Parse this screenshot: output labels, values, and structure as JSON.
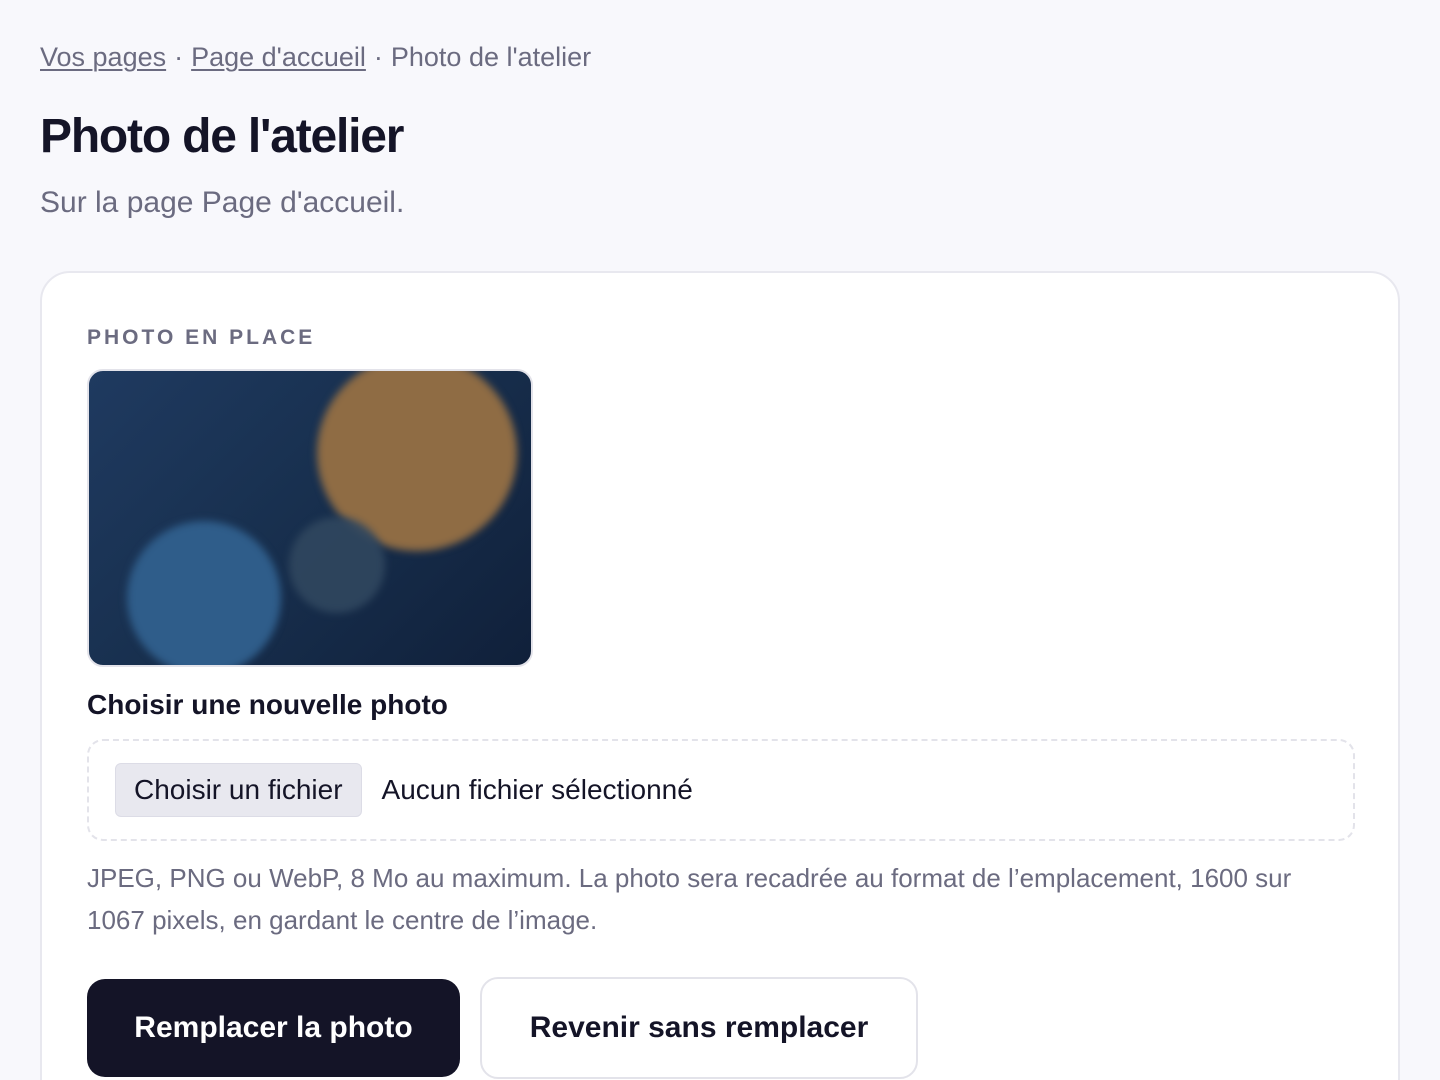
{
  "breadcrumb": {
    "items": [
      {
        "label": "Vos pages",
        "link": true
      },
      {
        "label": "Page d'accueil",
        "link": true
      },
      {
        "label": "Photo de l'atelier",
        "link": false
      }
    ],
    "separator": "·"
  },
  "header": {
    "title": "Photo de l'atelier",
    "subtitle": "Sur la page Page d'accueil."
  },
  "card": {
    "section_label": "PHOTO EN PLACE",
    "photo_alt": "Photo actuelle de l'atelier",
    "field_label": "Choisir une nouvelle photo",
    "file_input": {
      "button_label": "Choisir un fichier",
      "status": "Aucun fichier sélectionné"
    },
    "help_text": "JPEG, PNG ou WebP, 8 Mo au maximum. La photo sera recadrée au format de l’emplacement, 1600 sur 1067 pixels, en gardant le centre de l’image.",
    "primary_button": "Remplacer la photo",
    "secondary_button": "Revenir sans remplacer"
  },
  "colors": {
    "background": "#f8f8fc",
    "text_primary": "#141427",
    "text_muted": "#6b6b80",
    "primary_button": "#141427",
    "border": "#e3e3ea"
  }
}
